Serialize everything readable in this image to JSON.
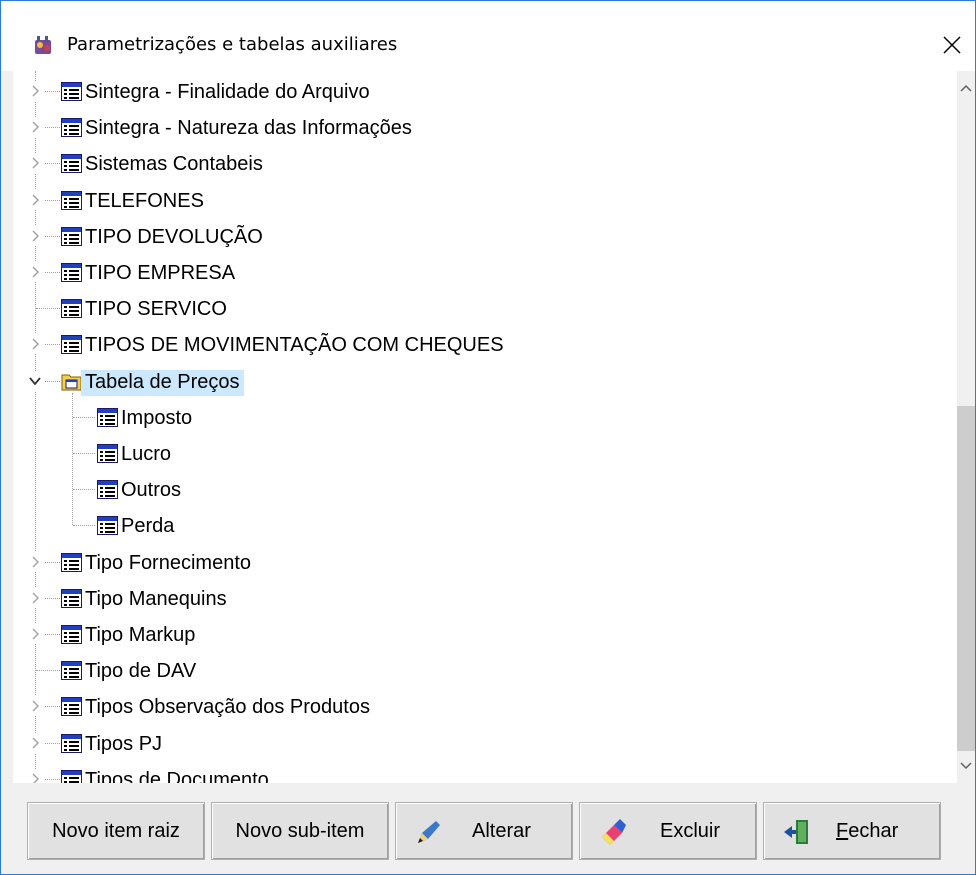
{
  "window": {
    "title": "Parametrizações e tabelas auxiliares",
    "icon": "app-icon",
    "close_icon": "close-icon"
  },
  "tree": {
    "items": [
      {
        "label": "Sintegra - Finalidade do Arquivo",
        "icon": "table-icon",
        "expandable": true
      },
      {
        "label": "Sintegra - Natureza das Informações",
        "icon": "table-icon",
        "expandable": true
      },
      {
        "label": "Sistemas Contabeis",
        "icon": "table-icon",
        "expandable": true
      },
      {
        "label": "TELEFONES",
        "icon": "table-icon",
        "expandable": true
      },
      {
        "label": "TIPO DEVOLUÇÃO",
        "icon": "table-icon",
        "expandable": true
      },
      {
        "label": "TIPO EMPRESA",
        "icon": "table-icon",
        "expandable": true
      },
      {
        "label": "TIPO SERVICO",
        "icon": "table-icon",
        "expandable": false
      },
      {
        "label": "TIPOS DE MOVIMENTAÇÃO COM CHEQUES",
        "icon": "table-icon",
        "expandable": true
      },
      {
        "label": "Tabela de Preços",
        "icon": "folder-table-icon",
        "expandable": true,
        "expanded": true,
        "selected": true
      },
      {
        "label": "Imposto",
        "icon": "table-icon",
        "child": true
      },
      {
        "label": "Lucro",
        "icon": "table-icon",
        "child": true
      },
      {
        "label": "Outros",
        "icon": "table-icon",
        "child": true
      },
      {
        "label": "Perda",
        "icon": "table-icon",
        "child": true
      },
      {
        "label": "Tipo Fornecimento",
        "icon": "table-icon",
        "expandable": true
      },
      {
        "label": "Tipo Manequins",
        "icon": "table-icon",
        "expandable": true
      },
      {
        "label": "Tipo Markup",
        "icon": "table-icon",
        "expandable": true
      },
      {
        "label": "Tipo de DAV",
        "icon": "table-icon",
        "expandable": false
      },
      {
        "label": "Tipos Observação dos Produtos",
        "icon": "table-icon",
        "expandable": true
      },
      {
        "label": "Tipos PJ",
        "icon": "table-icon",
        "expandable": true
      },
      {
        "label": "Tipos de Documento",
        "icon": "table-icon",
        "expandable": true
      }
    ]
  },
  "buttons": {
    "novo_raiz": "Novo item raiz",
    "novo_sub": "Novo sub-item",
    "alterar": "Alterar",
    "excluir": "Excluir",
    "fechar_first": "F",
    "fechar_rest": "echar"
  },
  "colors": {
    "selection": "#cce8ff",
    "border": "#2b7bd9",
    "scroll_thumb": "#cdcdcd"
  }
}
